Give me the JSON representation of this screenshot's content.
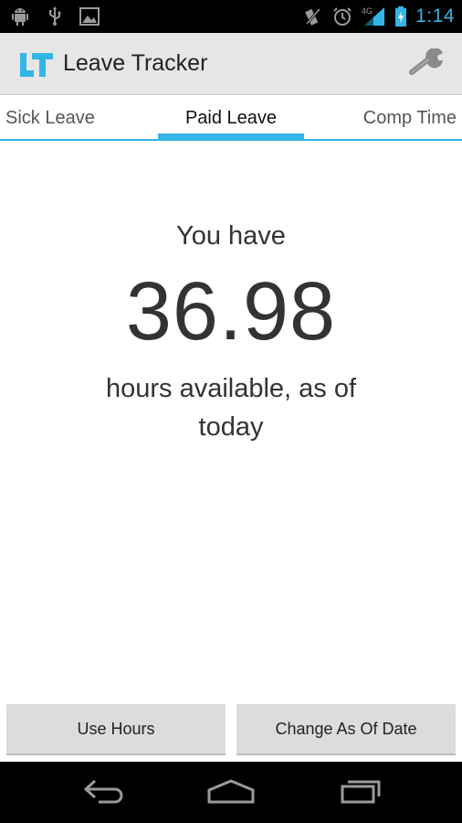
{
  "status_bar": {
    "time": "1:14",
    "network_label": "4G",
    "left_icons": [
      "android-debug-icon",
      "usb-icon",
      "image-icon"
    ],
    "right_icons": [
      "mute-icon",
      "alarm-icon",
      "signal-icon",
      "battery-icon"
    ],
    "accent_color": "#33b5e5"
  },
  "action_bar": {
    "logo_text": "LT",
    "title": "Leave Tracker",
    "settings_icon": "wrench-icon"
  },
  "tabs": [
    {
      "label": "Sick Leave",
      "selected": false
    },
    {
      "label": "Paid Leave",
      "selected": true
    },
    {
      "label": "Comp Time",
      "selected": false
    }
  ],
  "summary": {
    "prefix": "You have",
    "hours": "36.98",
    "suffix": "hours available, as of today"
  },
  "buttons": {
    "use_hours": "Use Hours",
    "change_date": "Change As Of Date"
  },
  "nav_bar": {
    "icons": [
      "back-icon",
      "home-icon",
      "recent-apps-icon"
    ]
  }
}
